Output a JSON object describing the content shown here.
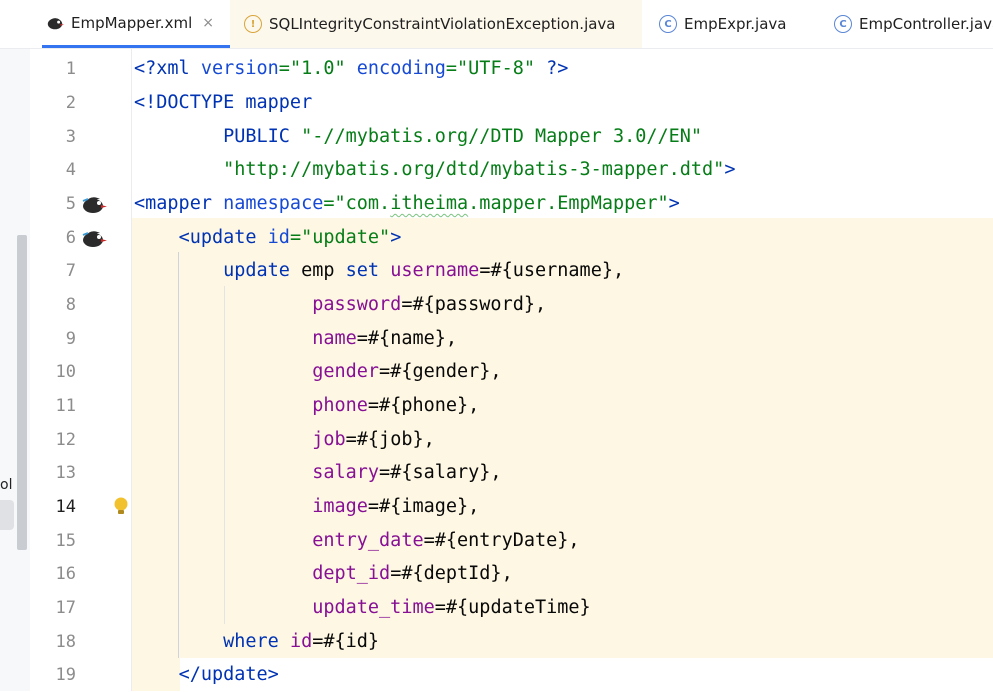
{
  "tabs": [
    {
      "label": "EmpMapper.xml",
      "icon": "mybatis-bird-icon",
      "active": true,
      "close": "×"
    },
    {
      "label": "SQLIntegrityConstraintViolationException.java",
      "icon": "exception-class-icon"
    },
    {
      "label": "EmpExpr.java",
      "icon": "class-icon"
    },
    {
      "label": "EmpController.java",
      "icon": "class-icon"
    }
  ],
  "left_panel": {
    "fragment": "ol"
  },
  "gutter": {
    "line_numbers": [
      "1",
      "2",
      "3",
      "4",
      "5",
      "6",
      "7",
      "8",
      "9",
      "10",
      "11",
      "12",
      "13",
      "14",
      "15",
      "16",
      "17",
      "18",
      "19"
    ],
    "current_line": "14"
  },
  "code": {
    "l1": {
      "t1": "<?xml ",
      "a1": "version",
      "e1": "=",
      "s1": "\"1.0\"",
      "sp": " ",
      "a2": "encoding",
      "e2": "=",
      "s2": "\"UTF-8\"",
      "t2": " ?>"
    },
    "l2": {
      "t1": "<!DOCTYPE mapper"
    },
    "l3": {
      "pre": "        ",
      "t1": "PUBLIC ",
      "s1": "\"-//mybatis.org//DTD Mapper 3.0//EN\""
    },
    "l4": {
      "pre": "        ",
      "s1": "\"http://mybatis.org/dtd/mybatis-3-mapper.dtd\"",
      "t1": ">"
    },
    "l5": {
      "t1": "<mapper ",
      "a1": "namespace",
      "e1": "=",
      "s1a": "\"com.",
      "s1b": "itheima",
      "s1c": ".mapper.EmpMapper\"",
      "t2": ">"
    },
    "l6": {
      "pre": "    ",
      "t1": "<update ",
      "a1": "id",
      "e1": "=",
      "s1": "\"update\"",
      "t2": ">"
    },
    "l7": {
      "pre": "        ",
      "k1": "update ",
      "p1": "emp ",
      "k2": "set ",
      "f1": "username",
      "p2": "=#{username},"
    },
    "l8": {
      "pre": "                ",
      "f1": "password",
      "p1": "=#{password},"
    },
    "l9": {
      "pre": "                ",
      "f1": "name",
      "p1": "=#{name},"
    },
    "l10": {
      "pre": "                ",
      "f1": "gender",
      "p1": "=#{gender},"
    },
    "l11": {
      "pre": "                ",
      "f1": "phone",
      "p1": "=#{phone},"
    },
    "l12": {
      "pre": "                ",
      "f1": "job",
      "p1": "=#{job},"
    },
    "l13": {
      "pre": "                ",
      "f1": "salary",
      "p1": "=#{salary},"
    },
    "l14": {
      "pre": "                ",
      "f1": "image",
      "p1": "=#{image},"
    },
    "l15": {
      "pre": "                ",
      "f1": "entry_date",
      "p1": "=#{entryDate},"
    },
    "l16": {
      "pre": "                ",
      "f1": "dept_id",
      "p1": "=#{deptId},"
    },
    "l17": {
      "pre": "                ",
      "f1": "update_time",
      "p1": "=#{updateTime}"
    },
    "l18": {
      "pre": "        ",
      "k1": "where ",
      "f1": "id",
      "p1": "=#{id}"
    },
    "l19": {
      "pre": "    ",
      "t1": "</update>"
    }
  },
  "colors": {
    "tag": "#0033b3",
    "attribute": "#174ad4",
    "string": "#067d17",
    "field": "#871094",
    "highlight": "#fdf7e3",
    "tab_active_underline": "#3574f0"
  }
}
